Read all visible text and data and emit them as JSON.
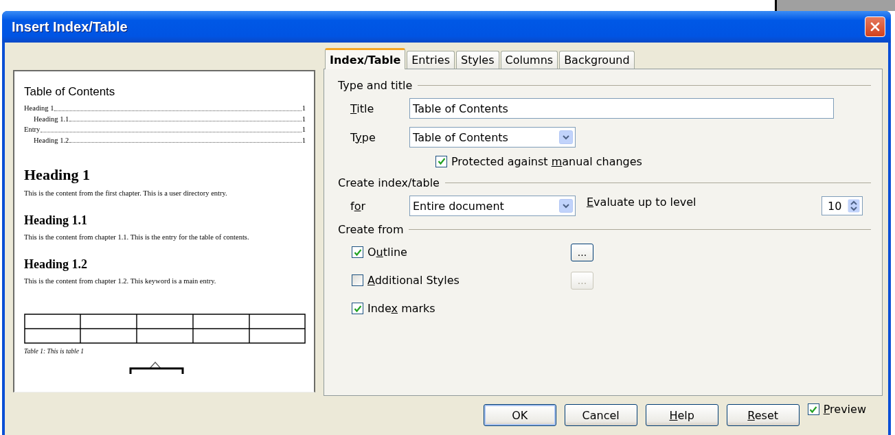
{
  "window": {
    "title": "Insert Index/Table"
  },
  "preview": {
    "toc_title": "Table of Contents",
    "toc_entries": [
      {
        "text": "Heading 1",
        "page": "1",
        "children": [
          {
            "text": "Heading 1.1",
            "page": "1"
          }
        ]
      },
      {
        "text": "Entry",
        "page": "1",
        "children": [
          {
            "text": "Heading 1.2",
            "page": "1"
          }
        ]
      }
    ],
    "sections": [
      {
        "kind": "heading1",
        "heading": "Heading 1",
        "text": "This is the content from the first chapter. This is a user directory entry."
      },
      {
        "kind": "heading2",
        "heading": "Heading 1.1",
        "text": "This is the content from chapter 1.1. This is the entry for the table of contents."
      },
      {
        "kind": "heading2",
        "heading": "Heading 1.2",
        "text": "This is the content from chapter 1.2. This keyword is a main entry."
      }
    ],
    "table_caption": "Table 1: This is table 1"
  },
  "tabs": [
    {
      "label": "Index/Table",
      "selected": true
    },
    {
      "label": "Entries",
      "selected": false
    },
    {
      "label": "Styles",
      "selected": false
    },
    {
      "label": "Columns",
      "selected": false
    },
    {
      "label": "Background",
      "selected": false
    }
  ],
  "type_and_title": {
    "heading": "Type and title",
    "title_label": {
      "key": "T",
      "post": "itle"
    },
    "title_value": "Table of Contents",
    "type_label": {
      "pre": "T",
      "key": "y",
      "post": "pe"
    },
    "type_value": "Table of Contents",
    "protected": {
      "label": {
        "pre": "Protected against ",
        "key": "m",
        "post": "anual changes"
      },
      "checked": true
    }
  },
  "create_index": {
    "heading": "Create index/table",
    "for_label": {
      "pre": "f",
      "key": "o",
      "post": "r"
    },
    "for_value": "Entire document",
    "level_label": {
      "key": "E",
      "post": "valuate up to level"
    },
    "level_value": "10"
  },
  "create_from": {
    "heading": "Create from",
    "options": [
      {
        "label": {
          "pre": "O",
          "key": "u",
          "post": "tline"
        },
        "checked": true,
        "button": "...",
        "button_disabled": false
      },
      {
        "label": {
          "key": "A",
          "post": "dditional Styles"
        },
        "checked": false,
        "button": "...",
        "button_disabled": true
      },
      {
        "label": {
          "pre": "Inde",
          "key": "x",
          "post": " marks"
        },
        "checked": true
      }
    ]
  },
  "buttons": [
    {
      "label": {
        "post": "OK"
      },
      "default": true
    },
    {
      "label": {
        "post": "Cancel"
      },
      "default": false
    },
    {
      "label": {
        "key": "H",
        "post": "elp"
      },
      "default": false
    },
    {
      "label": {
        "key": "R",
        "post": "eset"
      },
      "default": false
    }
  ],
  "preview_toggle": {
    "label": {
      "key": "P",
      "post": "review"
    },
    "checked": true
  }
}
